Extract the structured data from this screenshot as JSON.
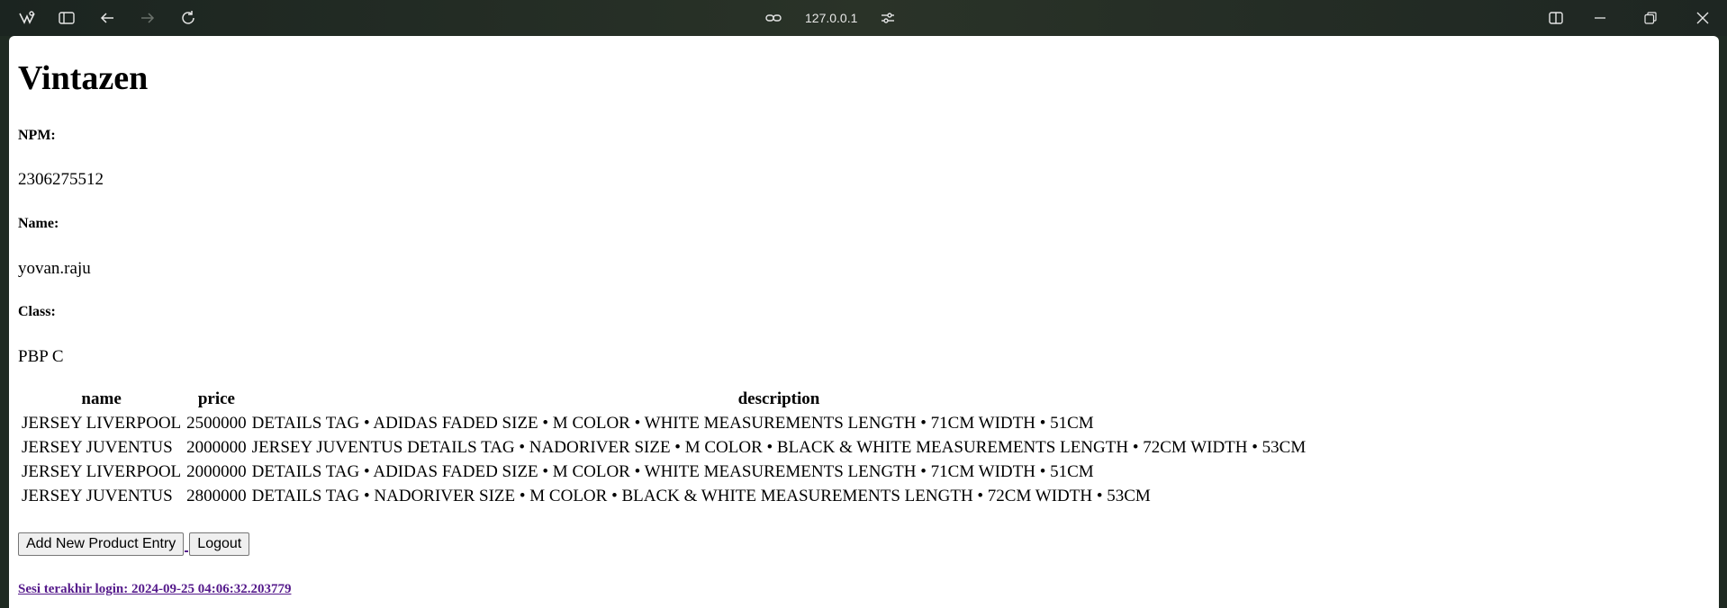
{
  "browser": {
    "url": "127.0.0.1",
    "icons": [
      "brand-icon",
      "sidebar-toggle-icon",
      "back-icon",
      "forward-icon",
      "reload-icon",
      "link-icon",
      "site-settings-icon",
      "split-view-icon",
      "minimize-icon",
      "restore-icon",
      "close-icon"
    ]
  },
  "page": {
    "title": "Vintazen",
    "npm_label": "NPM:",
    "npm_value": "2306275512",
    "name_label": "Name:",
    "name_value": "yovan.raju",
    "class_label": "Class:",
    "class_value": "PBP C"
  },
  "table": {
    "headers": [
      "name",
      "price",
      "description"
    ],
    "rows": [
      [
        "JERSEY LIVERPOOL",
        "2500000",
        "DETAILS TAG • ADIDAS FADED SIZE • M COLOR • WHITE MEASUREMENTS LENGTH • 71CM WIDTH • 51CM"
      ],
      [
        "JERSEY JUVENTUS",
        "2000000",
        "JERSEY JUVENTUS DETAILS TAG • NADORIVER SIZE • M COLOR • BLACK & WHITE MEASUREMENTS LENGTH • 72CM WIDTH • 53CM"
      ],
      [
        "JERSEY LIVERPOOL",
        "2000000",
        "DETAILS TAG • ADIDAS FADED SIZE • M COLOR • WHITE MEASUREMENTS LENGTH • 71CM WIDTH • 51CM"
      ],
      [
        "JERSEY JUVENTUS",
        "2800000",
        "DETAILS TAG • NADORIVER SIZE • M COLOR • BLACK & WHITE MEASUREMENTS LENGTH • 72CM WIDTH • 53CM"
      ]
    ]
  },
  "actions": {
    "add_label": "Add New Product Entry",
    "logout_label": "Logout"
  },
  "last_login": "Sesi terakhir login: 2024-09-25 04:06:32.203779"
}
